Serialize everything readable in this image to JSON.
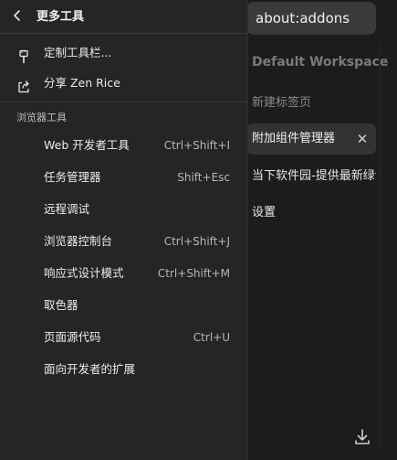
{
  "sidebar": {
    "url": "about:addons",
    "workspace": "Default Workspace",
    "tabs": [
      {
        "label": "新建标签页"
      },
      {
        "label": "附加组件管理器",
        "close_glyph": "✕"
      },
      {
        "label": "当下软件园-提供最新绿色"
      },
      {
        "label": "设置"
      }
    ],
    "download_icon": "download-icon"
  },
  "menu": {
    "back_icon": "chevron-left-icon",
    "title": "更多工具",
    "top_items": [
      {
        "icon": "brush-icon",
        "label": "定制工具栏..."
      },
      {
        "icon": "share-icon",
        "label": "分享 Zen Rice"
      }
    ],
    "section_title": "浏览器工具",
    "tools": [
      {
        "label": "Web 开发者工具",
        "shortcut": "Ctrl+Shift+I"
      },
      {
        "label": "任务管理器",
        "shortcut": "Shift+Esc"
      },
      {
        "label": "远程调试",
        "shortcut": ""
      },
      {
        "label": "浏览器控制台",
        "shortcut": "Ctrl+Shift+J"
      },
      {
        "label": "响应式设计模式",
        "shortcut": "Ctrl+Shift+M"
      },
      {
        "label": "取色器",
        "shortcut": ""
      },
      {
        "label": "页面源代码",
        "shortcut": "Ctrl+U"
      },
      {
        "label": "面向开发者的扩展",
        "shortcut": ""
      }
    ]
  },
  "colors": {
    "menu_bg": "#252525",
    "sidebar_bg": "#1c1c1c",
    "active_tab_bg": "#323232",
    "text": "#ececec",
    "muted": "#b6b6b6"
  }
}
